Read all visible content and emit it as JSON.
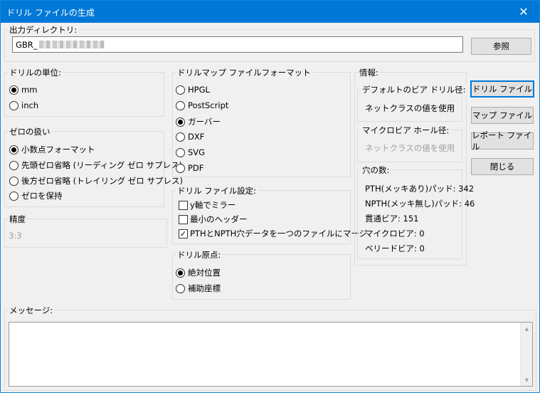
{
  "window": {
    "title": "ドリル ファイルの生成",
    "close_glyph": "✕"
  },
  "output_dir": {
    "label": "出力ディレクトリ:",
    "value_prefix": "GBR_",
    "browse_label": "参照"
  },
  "units": {
    "label": "ドリルの単位:",
    "options": [
      "mm",
      "inch"
    ],
    "selected": "mm"
  },
  "zeros": {
    "label": "ゼロの扱い",
    "options": [
      "小数点フォーマット",
      "先頭ゼロ省略 (リーディング ゼロ サプレス)",
      "後方ゼロ省略 (トレイリング ゼロ サプレス)",
      "ゼロを保持"
    ],
    "selected": "小数点フォーマット"
  },
  "precision": {
    "label": "精度",
    "value": "3:3"
  },
  "map_format": {
    "label": "ドリルマップ ファイルフォーマット",
    "options": [
      "HPGL",
      "PostScript",
      "ガーバー",
      "DXF",
      "SVG",
      "PDF"
    ],
    "selected": "ガーバー"
  },
  "file_settings": {
    "label": "ドリル ファイル設定:",
    "options": [
      {
        "label": "y軸でミラー",
        "checked": false
      },
      {
        "label": "最小のヘッダー",
        "checked": false
      },
      {
        "label": "PTHとNPTH穴データを一つのファイルにマージ",
        "checked": true
      }
    ]
  },
  "origin": {
    "label": "ドリル原点:",
    "options": [
      "絶対位置",
      "補助座標"
    ],
    "selected": "絶対位置"
  },
  "info": {
    "label": "情報:",
    "default_via": {
      "label": "デフォルトのビア ドリル径:",
      "value": "ネットクラスの値を使用"
    },
    "micro_via": {
      "label": "マイクロビア ホール径:",
      "value": "ネットクラスの値を使用"
    },
    "holes": {
      "label": "穴の数:",
      "items": [
        "PTH(メッキあり)パッド: 342",
        "NPTH(メッキ無し)パッド: 46",
        "貫通ビア: 151",
        "マイクロビア: 0",
        "ベリードビア: 0"
      ]
    }
  },
  "buttons": {
    "drill_file": "ドリル ファイル",
    "map_file": "マップ ファイル",
    "report_file": "レポート ファイル",
    "close": "閉じる"
  },
  "messages": {
    "label": "メッセージ:"
  },
  "icons": {
    "radio_checked": "radio-checked-icon",
    "checkbox_checked": "✓",
    "scroll_up": "▲",
    "scroll_down": "▼"
  }
}
